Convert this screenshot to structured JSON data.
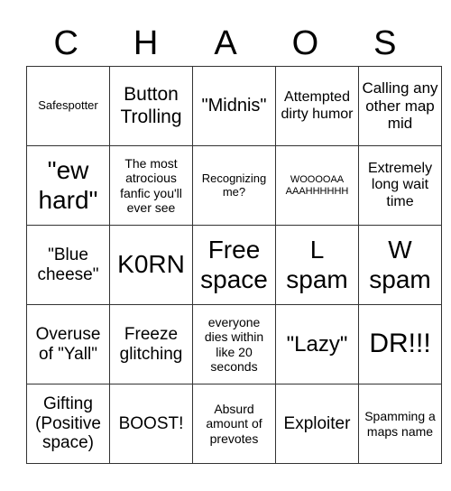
{
  "title_letters": [
    "C",
    "H",
    "A",
    "O",
    "S"
  ],
  "rows": [
    [
      "Safespotter",
      "Button Trolling",
      "\"Midnis\"",
      "Attempted dirty humor",
      "Calling any other map mid"
    ],
    [
      "\"ew hard\"",
      "The most atrocious fanfic you'll ever see",
      "Recognizing me?",
      "WOOOOAA AAAHHHHHH",
      "Extremely long wait time"
    ],
    [
      "\"Blue cheese\"",
      "K0RN",
      "Free space",
      "L spam",
      "W spam"
    ],
    [
      "Overuse of \"Yall\"",
      "Freeze glitching",
      "everyone dies within like 20 seconds",
      "\"Lazy\"",
      "DR!!!"
    ],
    [
      "Gifting (Positive space)",
      "BOOST!",
      "Absurd amount of prevotes",
      "Exploiter",
      "Spamming a maps name"
    ]
  ]
}
